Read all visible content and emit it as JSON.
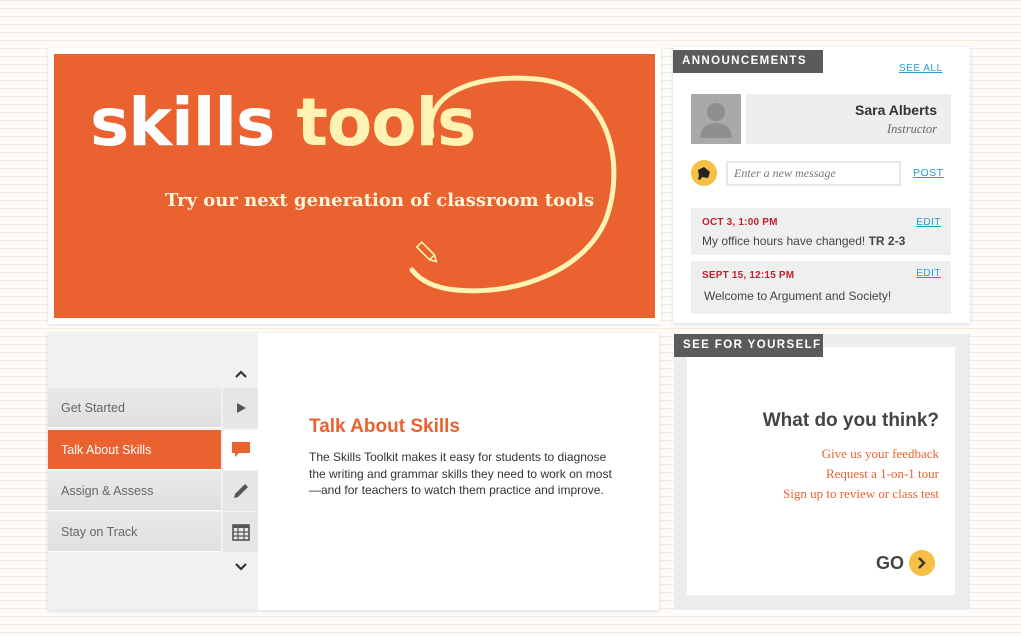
{
  "hero": {
    "title_part1": "skills",
    "title_part2": "tools",
    "subtitle": "Try our next generation of classroom tools"
  },
  "announcements": {
    "heading": "ANNOUNCEMENTS",
    "see_all": "SEE ALL",
    "profile": {
      "name": "Sara Alberts",
      "role": "Instructor"
    },
    "message_placeholder": "Enter a new message",
    "post_label": "POST",
    "items": [
      {
        "date": "OCT 3, 1:00 PM",
        "text": "My office hours have changed!",
        "highlight": "TR 2-3",
        "edit_label": "EDIT"
      },
      {
        "date": "SEPT 15, 12:15 PM",
        "text": "Welcome to Argument and Society!",
        "edit_label": "EDIT"
      }
    ]
  },
  "skills_nav": {
    "items": [
      {
        "label": "Get Started",
        "icon": "play-icon",
        "active": false
      },
      {
        "label": "Talk About Skills",
        "icon": "chat-icon",
        "active": true
      },
      {
        "label": "Assign & Assess",
        "icon": "pencil-icon",
        "active": false
      },
      {
        "label": "Stay on Track",
        "icon": "calendar-icon",
        "active": false
      }
    ]
  },
  "skill_detail": {
    "title": "Talk About Skills",
    "description": "The Skills Toolkit makes it easy for students to diagnose the writing and grammar skills they need to work on most—and for teachers to watch them practice and improve."
  },
  "see_for_yourself": {
    "heading": "SEE FOR YOURSELF",
    "question": "What do you think?",
    "links": [
      "Give us your feedback",
      "Request a 1-on-1 tour",
      "Sign up to review or class test"
    ],
    "go_label": "GO"
  },
  "colors": {
    "brand_orange": "#e9622f",
    "accent_yellow": "#f5c043",
    "link_blue": "#2a9bd0",
    "date_red": "#c2202c",
    "header_gray": "#5b5b5b"
  }
}
